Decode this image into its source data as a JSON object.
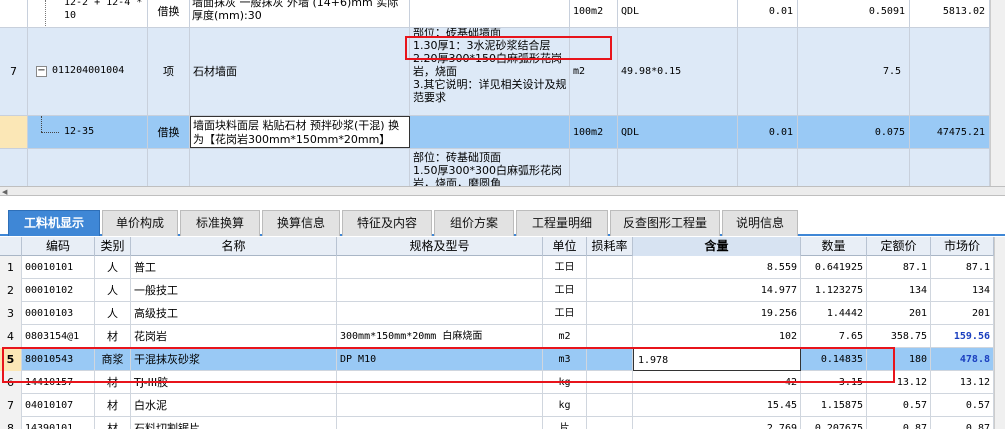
{
  "top_rows": [
    {
      "num": "",
      "code": "12-2 + 12-4 * 10",
      "type": "借换",
      "name": "墙面抹灰 一般抹灰 外墙 (14+6)mm 实际厚度(mm):30",
      "features": "",
      "unit": "100m2",
      "expr": "QDL",
      "qty": "0.01",
      "content": "0.5091",
      "total": "5813.02"
    },
    {
      "num": "7",
      "code": "011204001004",
      "type": "项",
      "name": "石材墙面",
      "features": [
        "部位：砖基础墙面",
        "1.30厚1：3水泥砂浆结合层",
        "2.20厚300*150白麻弧形花岗岩，烧面",
        "3.其它说明：详见相关设计及规范要求"
      ],
      "unit": "m2",
      "expr": "49.98*0.15",
      "qty": "",
      "content": "7.5",
      "total": ""
    },
    {
      "num": "",
      "code": "12-35",
      "type": "借换",
      "name": "墙面块料面层 粘贴石材 预拌砂浆(干混) 换为【花岗岩300mm*150mm*20mm】",
      "features": "",
      "unit": "100m2",
      "expr": "QDL",
      "qty": "0.01",
      "content": "0.075",
      "total": "47475.21"
    },
    {
      "num": "",
      "code": "",
      "type": "",
      "name": "",
      "features": [
        "部位：砖基础顶面",
        "1.50厚300*300白麻弧形花岗岩，烧面，磨圆角"
      ],
      "unit": "",
      "expr": "",
      "qty": "",
      "content": "",
      "total": ""
    }
  ],
  "tabs": [
    "工料机显示",
    "单价构成",
    "标准换算",
    "换算信息",
    "特征及内容",
    "组价方案",
    "工程量明细",
    "反查图形工程量",
    "说明信息"
  ],
  "headers": [
    "编码",
    "类别",
    "名称",
    "规格及型号",
    "单位",
    "损耗率",
    "含量",
    "数量",
    "定额价",
    "市场价"
  ],
  "rows": [
    {
      "no": "1",
      "code": "00010101",
      "cat": "人",
      "name": "普工",
      "spec": "",
      "unit": "工日",
      "loss": "",
      "content": "8.559",
      "qty": "0.641925",
      "price": "87.1",
      "market": "87.1"
    },
    {
      "no": "2",
      "code": "00010102",
      "cat": "人",
      "name": "一般技工",
      "spec": "",
      "unit": "工日",
      "loss": "",
      "content": "14.977",
      "qty": "1.123275",
      "price": "134",
      "market": "134"
    },
    {
      "no": "3",
      "code": "00010103",
      "cat": "人",
      "name": "高级技工",
      "spec": "",
      "unit": "工日",
      "loss": "",
      "content": "19.256",
      "qty": "1.4442",
      "price": "201",
      "market": "201"
    },
    {
      "no": "4",
      "code": "0803154@1",
      "cat": "材",
      "name": "花岗岩",
      "spec": "300mm*150mm*20mm 白麻烧面",
      "unit": "m2",
      "loss": "",
      "content": "102",
      "qty": "7.65",
      "price": "358.75",
      "market": "159.56"
    },
    {
      "no": "5",
      "code": "80010543",
      "cat": "商浆",
      "name": "干混抹灰砂浆",
      "spec": "DP M10",
      "unit": "m3",
      "loss": "",
      "content": "1.978",
      "qty": "0.14835",
      "price": "180",
      "market": "478.8"
    },
    {
      "no": "6",
      "code": "14410157",
      "cat": "材",
      "name": "TJ-III胶",
      "spec": "",
      "unit": "kg",
      "loss": "",
      "content": "42",
      "qty": "3.15",
      "price": "13.12",
      "market": "13.12"
    },
    {
      "no": "7",
      "code": "04010107",
      "cat": "材",
      "name": "白水泥",
      "spec": "",
      "unit": "kg",
      "loss": "",
      "content": "15.45",
      "qty": "1.15875",
      "price": "0.57",
      "market": "0.57"
    },
    {
      "no": "8",
      "code": "14390101",
      "cat": "材",
      "name": "石料切割锯片",
      "spec": "",
      "unit": "片",
      "loss": "",
      "content": "2.769",
      "qty": "0.207675",
      "price": "0.87",
      "market": "0.87"
    }
  ],
  "colors": {
    "tab_active": "#3f87d6",
    "row_selected": "#99c9f5",
    "highlight": "#dde9f7",
    "market_blue": "#1a3fbf",
    "annotation_red": "#e8141b"
  }
}
